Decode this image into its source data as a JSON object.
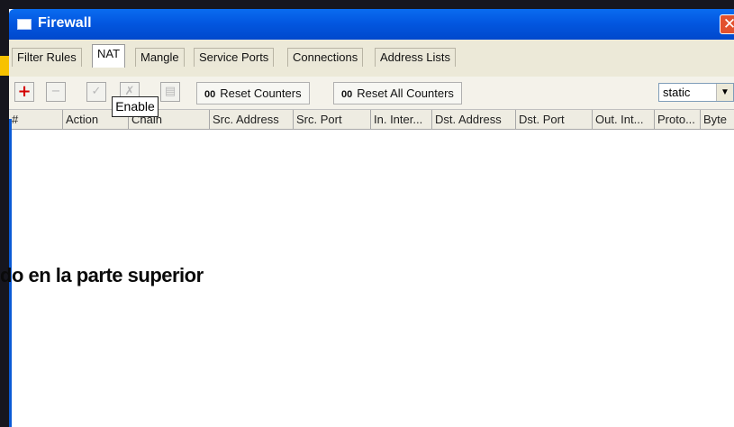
{
  "window": {
    "title": "Firewall",
    "close_glyph": "✕"
  },
  "tabs": [
    {
      "label": "Filter Rules"
    },
    {
      "label": "NAT"
    },
    {
      "label": "Mangle"
    },
    {
      "label": "Service Ports"
    },
    {
      "label": "Connections"
    },
    {
      "label": "Address Lists"
    }
  ],
  "active_tab": "NAT",
  "toolbar": {
    "add_glyph": "+",
    "remove_glyph": "−",
    "enable_glyph": "✓",
    "disable_glyph": "✗",
    "comment_glyph": "▤",
    "reset_counters_label": "Reset Counters",
    "reset_all_counters_label": "Reset All Counters",
    "counter_badge": "00",
    "filter_value": "static",
    "dropdown_arrow": "▼"
  },
  "tooltip": {
    "text": "Enable"
  },
  "table": {
    "columns": [
      "#",
      "Action",
      "Chain",
      "Src. Address",
      "Src. Port",
      "In. Inter...",
      "Dst. Address",
      "Dst. Port",
      "Out. Int...",
      "Proto...",
      "Byte"
    ]
  },
  "overlay_caption": "do en la parte superior",
  "colors": {
    "titlebar": "#0357e0",
    "accent": "#f7c200",
    "add": "#d40000"
  },
  "icons": [
    "window-icon",
    "close-icon",
    "add-icon",
    "remove-icon",
    "enable-icon",
    "disable-icon",
    "comment-icon",
    "dropdown-arrow-icon"
  ]
}
